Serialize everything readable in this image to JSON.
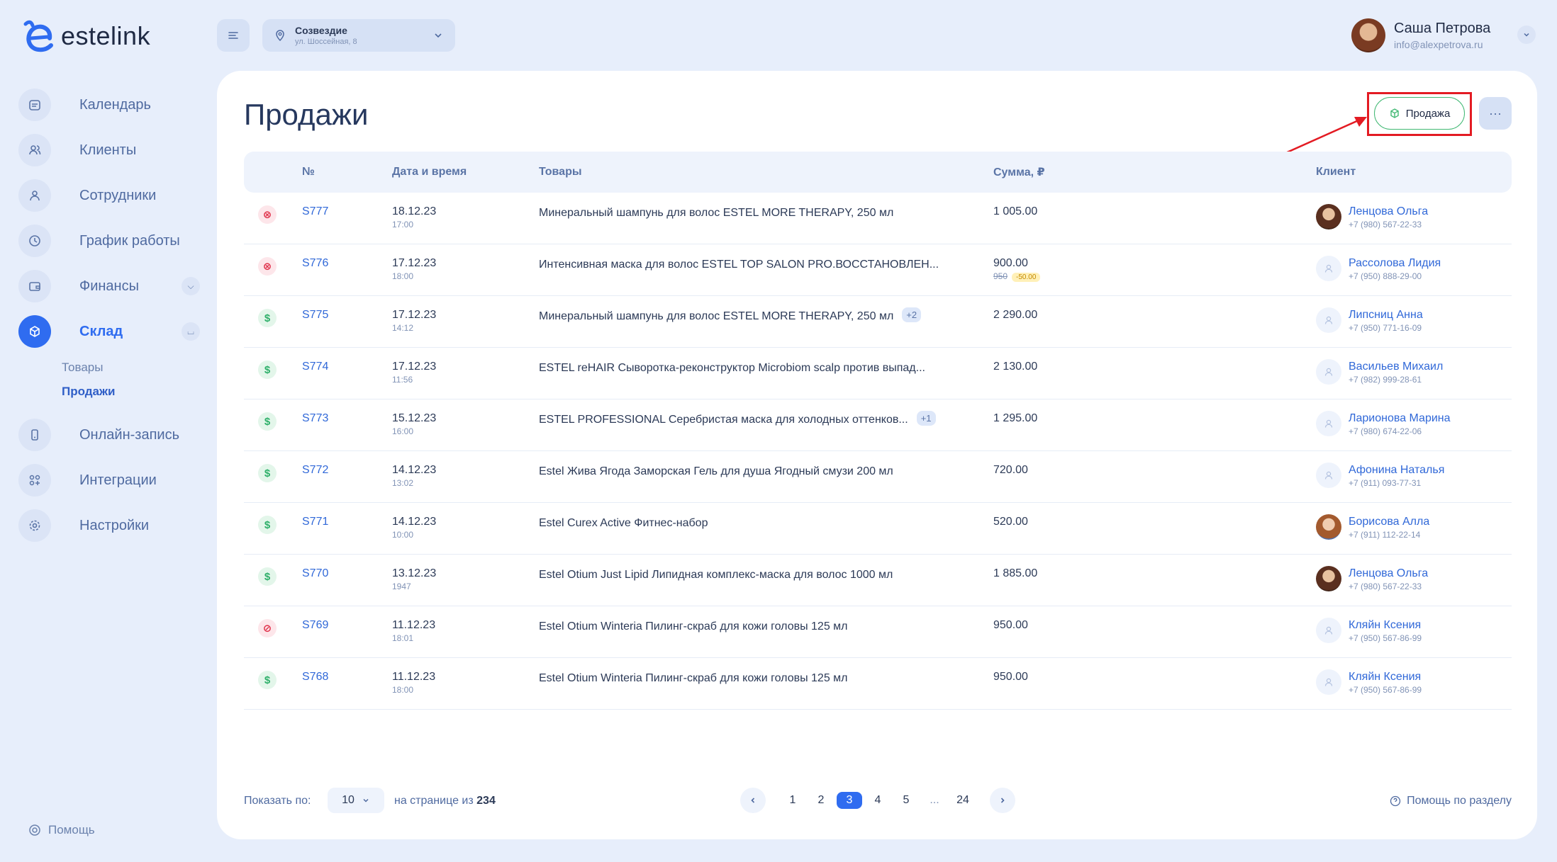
{
  "brand": {
    "name": "estelink"
  },
  "location": {
    "name": "Созвездие",
    "address": "ул. Шоссейная, 8"
  },
  "user": {
    "name": "Саша Петрова",
    "email": "info@alexpetrova.ru"
  },
  "sidebar": {
    "items": [
      {
        "label": "Календарь"
      },
      {
        "label": "Клиенты"
      },
      {
        "label": "Сотрудники"
      },
      {
        "label": "График работы"
      },
      {
        "label": "Финансы"
      },
      {
        "label": "Склад"
      },
      {
        "label": "Онлайн-запись"
      },
      {
        "label": "Интеграции"
      },
      {
        "label": "Настройки"
      }
    ],
    "sub_items": [
      {
        "label": "Товары"
      },
      {
        "label": "Продажи"
      }
    ],
    "help": "Помощь"
  },
  "page": {
    "title": "Продажи",
    "sale_button": "Продажа",
    "more_button": "···"
  },
  "table": {
    "headers": {
      "num": "№",
      "date": "Дата и время",
      "goods": "Товары",
      "sum": "Сумма, ₽",
      "client": "Клиент"
    },
    "rows": [
      {
        "status": "cancelled",
        "num": "S777",
        "date": "18.12.23",
        "time": "17:00",
        "goods": "Минеральный шампунь для волос ESTEL MORE THERAPY, 250 мл",
        "extra": "",
        "sum": "1 005.00",
        "old_price": "",
        "discount": "",
        "client": "Ленцова Ольга",
        "phone": "+7 (980) 567-22-33",
        "avatar": "photo1"
      },
      {
        "status": "cancelled",
        "num": "S776",
        "date": "17.12.23",
        "time": "18:00",
        "goods": "Интенсивная маска для волос ESTEL TOP SALON PRO.ВОССТАНОВЛЕН...",
        "extra": "",
        "sum": "900.00",
        "old_price": "950",
        "discount": "-50.00",
        "client": "Рассолова Лидия",
        "phone": "+7 (950) 888-29-00",
        "avatar": "empty"
      },
      {
        "status": "paid",
        "num": "S775",
        "date": "17.12.23",
        "time": "14:12",
        "goods": "Минеральный шампунь для волос ESTEL MORE THERAPY, 250 мл",
        "extra": "+2",
        "sum": "2 290.00",
        "old_price": "",
        "discount": "",
        "client": "Липсниц Анна",
        "phone": "+7 (950) 771-16-09",
        "avatar": "empty"
      },
      {
        "status": "paid",
        "num": "S774",
        "date": "17.12.23",
        "time": "11:56",
        "goods": "ESTEL reHAIR Сыворотка-реконструктор Microbiom scalp против выпад...",
        "extra": "",
        "sum": "2 130.00",
        "old_price": "",
        "discount": "",
        "client": "Васильев Михаил",
        "phone": "+7 (982) 999-28-61",
        "avatar": "empty"
      },
      {
        "status": "paid",
        "num": "S773",
        "date": "15.12.23",
        "time": "16:00",
        "goods": "ESTEL PROFESSIONAL Серебристая маска для холодных оттенков...",
        "extra": "+1",
        "sum": "1 295.00",
        "old_price": "",
        "discount": "",
        "client": "Ларионова Марина",
        "phone": "+7 (980) 674-22-06",
        "avatar": "empty"
      },
      {
        "status": "paid",
        "num": "S772",
        "date": "14.12.23",
        "time": "13:02",
        "goods": "Estel Жива Ягода Заморская Гель для душа Ягодный смузи 200 мл",
        "extra": "",
        "sum": "720.00",
        "old_price": "",
        "discount": "",
        "client": "Афонина Наталья",
        "phone": "+7 (911) 093-77-31",
        "avatar": "empty"
      },
      {
        "status": "paid",
        "num": "S771",
        "date": "14.12.23",
        "time": "10:00",
        "goods": "Estel Curex Active Фитнес-набор",
        "extra": "",
        "sum": "520.00",
        "old_price": "",
        "discount": "",
        "client": "Борисова Алла",
        "phone": "+7 (911) 112-22-14",
        "avatar": "photo2"
      },
      {
        "status": "paid",
        "num": "S770",
        "date": "13.12.23",
        "time": "1947",
        "goods": "Estel Otium Just Lipid Липидная комплекс-маска для волос 1000 мл",
        "extra": "",
        "sum": "1 885.00",
        "old_price": "",
        "discount": "",
        "client": "Ленцова Ольга",
        "phone": "+7 (980) 567-22-33",
        "avatar": "photo1"
      },
      {
        "status": "blocked",
        "num": "S769",
        "date": "11.12.23",
        "time": "18:01",
        "goods": "Estel Otium Winteria Пилинг-скраб для кожи головы 125 мл",
        "extra": "",
        "sum": "950.00",
        "old_price": "",
        "discount": "",
        "client": "Кляйн Ксения",
        "phone": "+7 (950) 567-86-99",
        "avatar": "empty"
      },
      {
        "status": "paid",
        "num": "S768",
        "date": "11.12.23",
        "time": "18:00",
        "goods": "Estel Otium Winteria Пилинг-скраб для кожи головы 125 мл",
        "extra": "",
        "sum": "950.00",
        "old_price": "",
        "discount": "",
        "client": "Кляйн Ксения",
        "phone": "+7 (950) 567-86-99",
        "avatar": "empty"
      }
    ]
  },
  "footer": {
    "show_label": "Показать по:",
    "per_page": "10",
    "page_of_label": "на странице из",
    "total": "234",
    "pages": [
      "1",
      "2",
      "3",
      "4",
      "5",
      "...",
      "24"
    ],
    "current_page": "3",
    "help": "Помощь по разделу"
  },
  "colors": {
    "accent": "#2f6cf0",
    "success": "#41b873",
    "danger": "#e0344d",
    "highlight": "#e31b23"
  }
}
